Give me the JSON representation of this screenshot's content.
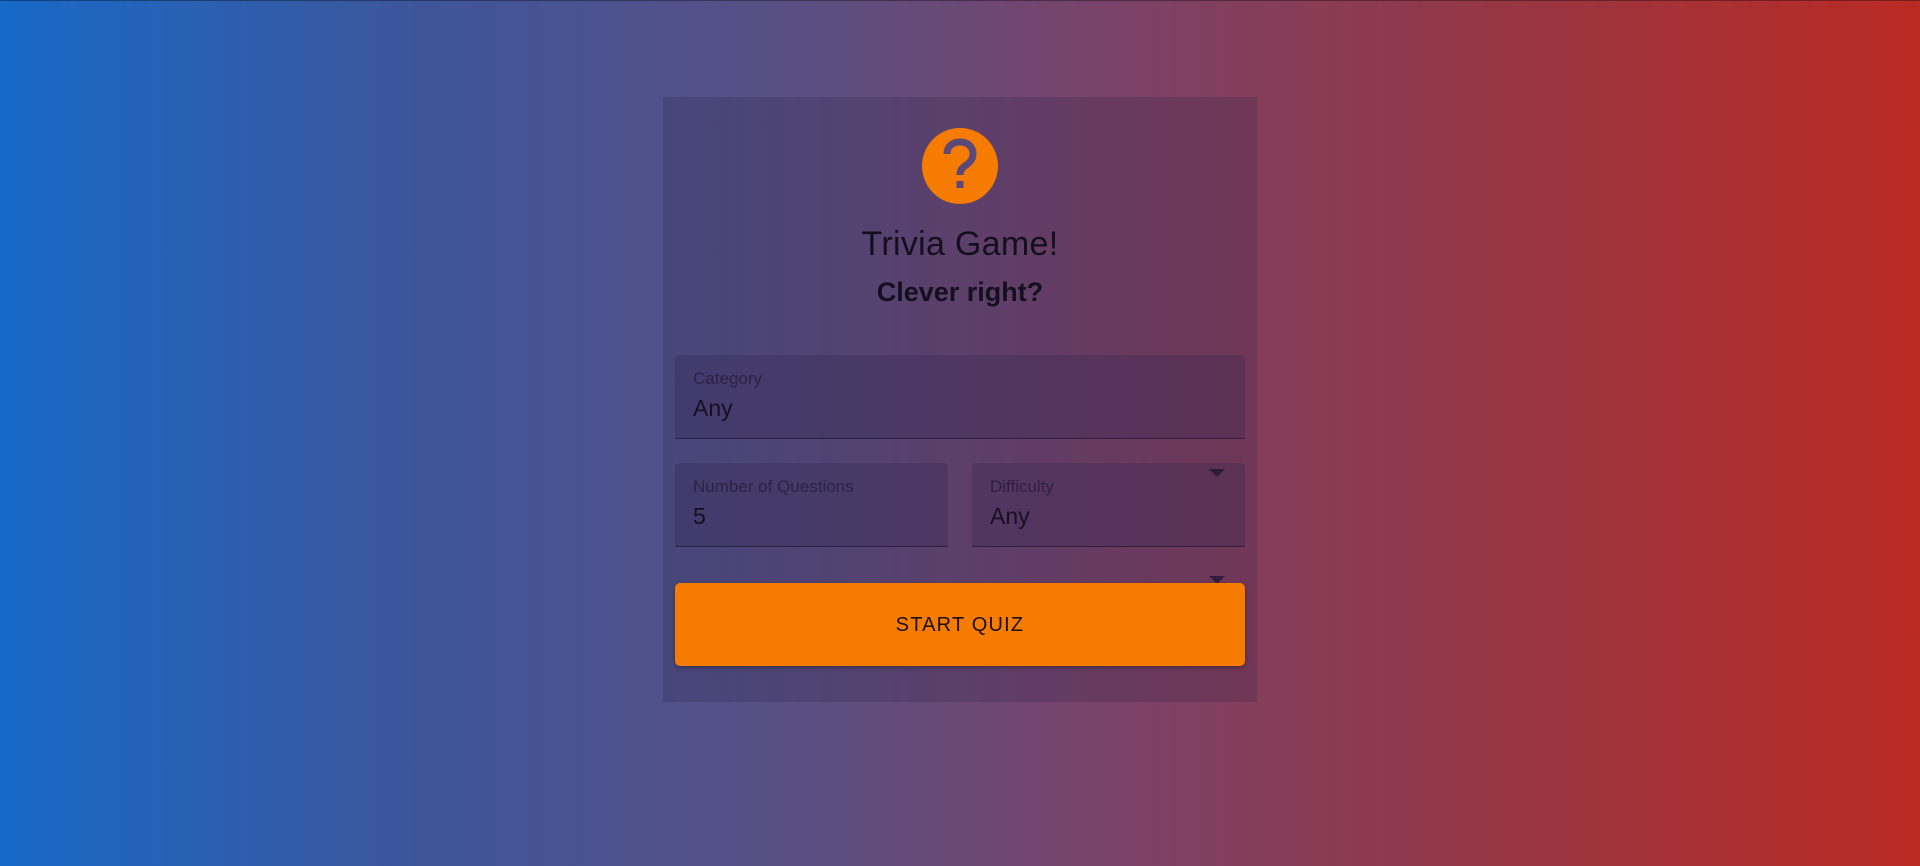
{
  "header": {
    "logo_icon": "question-mark-icon",
    "title": "Trivia Game!",
    "subtitle": "Clever right?"
  },
  "form": {
    "category": {
      "label": "Category",
      "value": "Any"
    },
    "number_of_questions": {
      "label": "Number of Questions",
      "value": "5"
    },
    "difficulty": {
      "label": "Difficulty",
      "value": "Any"
    }
  },
  "actions": {
    "start_label": "START QUIZ"
  },
  "colors": {
    "accent": "#f57c00",
    "gradient_left": "#1769c8",
    "gradient_right": "#bb2a24"
  }
}
